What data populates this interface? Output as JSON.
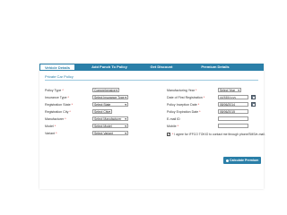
{
  "tabs": [
    {
      "label": "Vehicle Details",
      "active": true
    },
    {
      "label": "Add Punch To Policy",
      "active": false
    },
    {
      "label": "Get Discount",
      "active": false
    },
    {
      "label": "Premium Details",
      "active": false
    }
  ],
  "section_title": "Private Car Policy",
  "left_fields": [
    {
      "label": "Policy Type",
      "value": "Comprehensive",
      "kind": "select"
    },
    {
      "label": "Insurance Type",
      "value": "Select Insurance Type",
      "kind": "select"
    },
    {
      "label": "Registration State",
      "value": "Select State",
      "kind": "select"
    },
    {
      "label": "Registration City",
      "value": "Select City",
      "kind": "select"
    },
    {
      "label": "Manufacturer",
      "value": "Select Manufacturer",
      "kind": "select"
    },
    {
      "label": "Model",
      "value": "Select Model",
      "kind": "select"
    },
    {
      "label": "Variant",
      "value": "Select Variant",
      "kind": "select"
    }
  ],
  "right_fields": [
    {
      "label": "Manufacturing Year",
      "value": "Select Year",
      "kind": "select"
    },
    {
      "label": "Date of First Registration",
      "value": "dd/MM/yyyy",
      "kind": "date"
    },
    {
      "label": "Policy Inception Date",
      "value": "08/06/2014",
      "kind": "date"
    },
    {
      "label": "Policy Expiration Date",
      "value": "08/06/2015",
      "kind": "date"
    },
    {
      "label": "E-mail ID",
      "value": "",
      "kind": "text"
    },
    {
      "label": "Mobile",
      "value": "",
      "kind": "text"
    }
  ],
  "consent_text": "I agree for IFFCO TOKIO to contact me through phone/SMS/e-mail.",
  "calculate_button": "Calculate Premium",
  "colors": {
    "accent": "#2a7fa8",
    "required": "#d62828"
  },
  "icons": {
    "dropdown": "chevron-down-icon",
    "calendar": "calendar-icon"
  }
}
